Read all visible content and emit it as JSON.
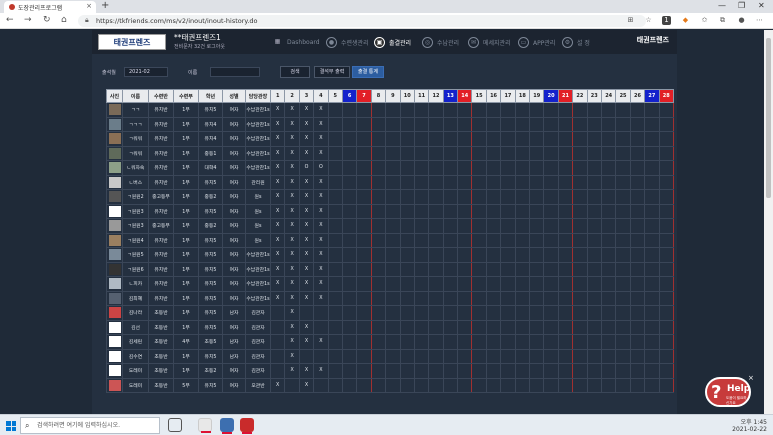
{
  "browser": {
    "tab_title": "도장관리프로그램",
    "url": "https://tkfriends.com/ms/v2/inout/inout-history.do"
  },
  "header": {
    "logo": "태권프렌즈",
    "org_name": "**태권프렌즈1",
    "org_sub": "전비문자 32건 로그아웃",
    "logo_right": "태권프렌즈",
    "menu": [
      {
        "label": "Dashboard",
        "icon": "dashboard-icon",
        "active": false
      },
      {
        "label": "수련생관리",
        "icon": "person-icon",
        "active": false
      },
      {
        "label": "출결관리",
        "icon": "calendar-icon",
        "active": true
      },
      {
        "label": "수납관리",
        "icon": "money-icon",
        "active": false
      },
      {
        "label": "메세지관리",
        "icon": "message-icon",
        "active": false
      },
      {
        "label": "APP관리",
        "icon": "app-icon",
        "active": false
      },
      {
        "label": "설 정",
        "icon": "gear-icon",
        "active": false
      }
    ]
  },
  "filter": {
    "date_label": "출석월",
    "date_value": "2021-02",
    "name_label": "이름",
    "name_value": "",
    "search_button": "검색",
    "absent_button": "결석부 출력",
    "monthly_button": "출결 통계"
  },
  "table": {
    "columns": [
      "사진",
      "이름",
      "수련반",
      "수련부",
      "학년",
      "성별",
      "담당관장"
    ],
    "days": [
      "1",
      "2",
      "3",
      "4",
      "5",
      "6",
      "7",
      "8",
      "9",
      "10",
      "11",
      "12",
      "13",
      "14",
      "15",
      "16",
      "17",
      "18",
      "19",
      "20",
      "21",
      "22",
      "23",
      "24",
      "25",
      "26",
      "27",
      "28"
    ],
    "saturday": [
      "6",
      "13",
      "20",
      "27"
    ],
    "sunday": [
      "7",
      "14",
      "21",
      "28"
    ],
    "rows": [
      {
        "name": "ㄱㄱ",
        "cls": "유치반",
        "part": "1부",
        "grade": "유치5",
        "sex": "여자",
        "teacher": "수납관찬1s",
        "att": [
          "X",
          "X",
          "X",
          "X"
        ]
      },
      {
        "name": "ㄱㄱㄱ",
        "cls": "유치반",
        "part": "1부",
        "grade": "유치4",
        "sex": "여자",
        "teacher": "수납관찬1s",
        "att": [
          "X",
          "X",
          "X",
          "X"
        ]
      },
      {
        "name": "ㄱ워워",
        "cls": "유치반",
        "part": "1부",
        "grade": "유치4",
        "sex": "여자",
        "teacher": "수납관찬1s",
        "att": [
          "X",
          "X",
          "X",
          "X"
        ]
      },
      {
        "name": "ㄱ워워",
        "cls": "유치반",
        "part": "1부",
        "grade": "중등1",
        "sex": "여자",
        "teacher": "수납관찬1s",
        "att": [
          "X",
          "X",
          "X",
          "X"
        ]
      },
      {
        "name": "ㄴ워자숙",
        "cls": "유치반",
        "part": "1부",
        "grade": "대학4",
        "sex": "여자",
        "teacher": "수납관찬1s",
        "att": [
          "X",
          "X",
          "O",
          "O"
        ]
      },
      {
        "name": "ㄴ버스",
        "cls": "유치반",
        "part": "1부",
        "grade": "유치5",
        "sex": "여자",
        "teacher": "관리원",
        "att": [
          "X",
          "X",
          "X",
          "X"
        ]
      },
      {
        "name": "ㄱ원원2",
        "cls": "중고등부",
        "part": "1부",
        "grade": "중등2",
        "sex": "여자",
        "teacher": "원s",
        "att": [
          "X",
          "X",
          "X",
          "X"
        ]
      },
      {
        "name": "ㄱ원원3",
        "cls": "유치반",
        "part": "1부",
        "grade": "유치5",
        "sex": "여자",
        "teacher": "원s",
        "att": [
          "X",
          "X",
          "X",
          "X"
        ]
      },
      {
        "name": "ㄱ원원3",
        "cls": "중고등부",
        "part": "1부",
        "grade": "중등2",
        "sex": "여자",
        "teacher": "원s",
        "att": [
          "X",
          "X",
          "X",
          "X"
        ]
      },
      {
        "name": "ㄱ원원4",
        "cls": "유치반",
        "part": "1부",
        "grade": "유치5",
        "sex": "여자",
        "teacher": "원s",
        "att": [
          "X",
          "X",
          "X",
          "X"
        ]
      },
      {
        "name": "ㄱ원원5",
        "cls": "유치반",
        "part": "1부",
        "grade": "유치5",
        "sex": "여자",
        "teacher": "수납관찬1s",
        "att": [
          "X",
          "X",
          "X",
          "X"
        ]
      },
      {
        "name": "ㄱ원원6",
        "cls": "유치반",
        "part": "1부",
        "grade": "유치5",
        "sex": "여자",
        "teacher": "수납관찬1s",
        "att": [
          "X",
          "X",
          "X",
          "X"
        ]
      },
      {
        "name": "ㄴ피카",
        "cls": "유치반",
        "part": "1부",
        "grade": "유치5",
        "sex": "여자",
        "teacher": "수납관찬1s",
        "att": [
          "X",
          "X",
          "X",
          "X"
        ]
      },
      {
        "name": "김최혜",
        "cls": "유치반",
        "part": "1부",
        "grade": "유치5",
        "sex": "여자",
        "teacher": "수납관찬1s",
        "att": [
          "X",
          "X",
          "X",
          "X"
        ]
      },
      {
        "name": "김나라",
        "cls": "초등반",
        "part": "1부",
        "grade": "유치5",
        "sex": "남자",
        "teacher": "김관자",
        "att": [
          "",
          "X",
          "",
          ""
        ]
      },
      {
        "name": "김선",
        "cls": "초등반",
        "part": "1부",
        "grade": "유치5",
        "sex": "여자",
        "teacher": "김관자",
        "att": [
          "",
          "X",
          "X",
          ""
        ]
      },
      {
        "name": "김세린",
        "cls": "초등반",
        "part": "4부",
        "grade": "초등5",
        "sex": "남자",
        "teacher": "김관자",
        "att": [
          "",
          "X",
          "X",
          "X"
        ]
      },
      {
        "name": "김수연",
        "cls": "초등반",
        "part": "1부",
        "grade": "유치5",
        "sex": "남자",
        "teacher": "김관자",
        "att": [
          "",
          "X",
          "",
          ""
        ]
      },
      {
        "name": "도레미",
        "cls": "초등반",
        "part": "1부",
        "grade": "초등2",
        "sex": "여자",
        "teacher": "김관자",
        "att": [
          "",
          "X",
          "X",
          "X"
        ]
      },
      {
        "name": "도레미",
        "cls": "초등반",
        "part": "5부",
        "grade": "유치5",
        "sex": "여자",
        "teacher": "오관반",
        "att": [
          "X",
          "",
          "X",
          ""
        ]
      }
    ]
  },
  "help": {
    "title": "Help",
    "sub": "도움이 필요하신가요",
    "close": "×"
  },
  "taskbar": {
    "search_placeholder": "검색하려면 여기에 입력하십시오.",
    "tray_lines": [
      "오후 1:45",
      "2021-02-22"
    ]
  }
}
